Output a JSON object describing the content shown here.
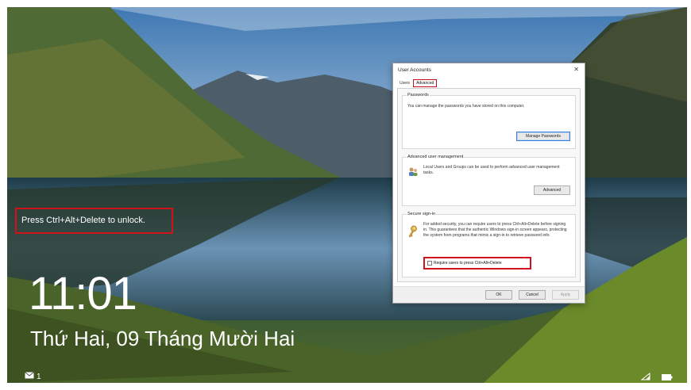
{
  "lock_screen": {
    "hint": "Press Ctrl+Alt+Delete to unlock.",
    "time": "11:01",
    "date": "Thứ Hai, 09 Tháng Mười Hai",
    "notification_count": "1"
  },
  "dialog": {
    "title": "User Accounts",
    "close_label": "✕",
    "tabs": [
      {
        "label": "Users",
        "active": false
      },
      {
        "label": "Advanced",
        "active": true
      }
    ],
    "passwords": {
      "title": "Passwords",
      "text": "You can manage the passwords you have stored on this computer.",
      "button": "Manage Passwords"
    },
    "advanced_user_management": {
      "title": "Advanced user management",
      "text": "Local Users and Groups can be used to perform advanced user management tasks.",
      "button": "Advanced"
    },
    "secure_signin": {
      "title": "Secure sign-in",
      "text": "For added security, you can require users to press Ctrl+Alt+Delete before signing in. This guarantees that the authentic Windows sign-in screen appears, protecting the system from programs that mimic a sign-in to retrieve password info.",
      "checkbox_label": "Require users to press Ctrl+Alt+Delete",
      "checked": false
    },
    "buttons": {
      "ok": "OK",
      "cancel": "Cancel",
      "apply": "Apply"
    }
  },
  "colors": {
    "highlight": "#d0121b",
    "focus_blue": "#3c7fd6"
  },
  "icons": [
    "mail-icon",
    "network-icon",
    "battery-icon",
    "users-group-icon",
    "key-icon"
  ]
}
